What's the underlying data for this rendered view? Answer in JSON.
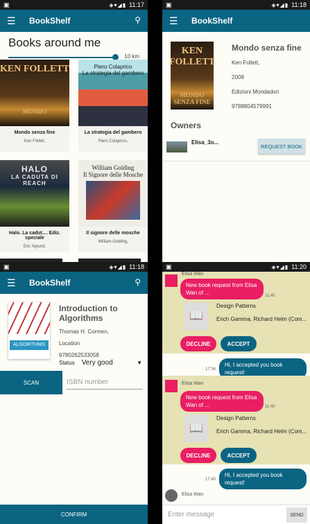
{
  "status_bar": {
    "q1_time": "11:17",
    "q2_time": "11:18",
    "q3_time": "11:18",
    "q4_time": "11:20"
  },
  "app_bar": {
    "title": "BookShelf"
  },
  "list_screen": {
    "heading": "Books around me",
    "distance_label": "10 km",
    "books": [
      {
        "title": "Mondo senza fine",
        "author": "Ken Follett,",
        "cover_top": "KEN FOLLETT",
        "cover_bottom": "MONDO"
      },
      {
        "title": "La strategia del gambero",
        "author": "Piero Colaprico,",
        "cover_top": "Piero Colaprico",
        "cover_bottom": "La strategia del gambero"
      },
      {
        "title": "Halo. La cadut.... Ediz. speciale",
        "author": "Eric Nylund,",
        "cover_top": "HALO",
        "cover_bottom": "LA CADUTA DI REACH"
      },
      {
        "title": "Il signore delle mosche",
        "author": "William Golding,",
        "cover_top": "William Golding",
        "cover_bottom": "Il Signore delle Mosche"
      }
    ]
  },
  "detail_screen": {
    "title": "Mondo senza fine",
    "author": "Ken Follett,",
    "year": "2008",
    "publisher": "Edizioni Mondadori",
    "isbn": "9788804579991",
    "cover_top": "KEN FOLLETT",
    "cover_bottom": "MONDO SENZA FINE",
    "owners_label": "Owners",
    "owner_name": "Elisa_3o...",
    "request_button": "REQUEST BOOK"
  },
  "add_screen": {
    "title": "Introduction to Algorithms",
    "authors": "Thomas H. Cormen,",
    "location": "Location",
    "isbn": "9780262533058",
    "status_label": "Status",
    "status_value": "Very good",
    "scan_button": "SCAN",
    "isbn_placeholder": "ISBN number",
    "confirm_button": "CONFIRM",
    "cover_title": "ALGORITHMS"
  },
  "chat_screen": {
    "sender": "Elisa Wan",
    "request_text": "New book request from Elisa Wan of ...",
    "request_time": "11:40",
    "book_title": "Design Patterns",
    "book_authors": "Erich Gamma, Richard Helm (Com...",
    "decline": "DECLINE",
    "accept": "ACCEPT",
    "reply_text": "Hi, I accepted you book request!",
    "reply_time_1": "17:34",
    "reply_time_2": "17:40",
    "input_placeholder": "Enter message",
    "send_button": "SEND"
  },
  "colors": {
    "primary": "#0a6482",
    "accent": "#e91e63",
    "request_bg": "#e6e2b4"
  }
}
